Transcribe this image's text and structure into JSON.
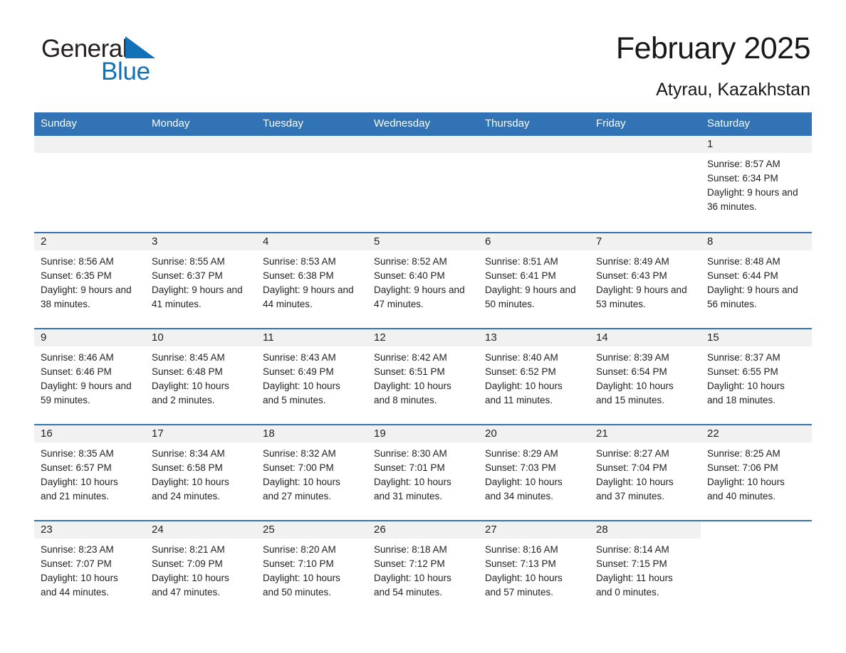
{
  "logo": {
    "word1": "General",
    "word2": "Blue",
    "triangle_color": "#1272b8"
  },
  "header": {
    "title": "February 2025",
    "subtitle": "Atyrau, Kazakhstan",
    "accent_color": "#3173b4"
  },
  "calendar": {
    "weekdays": [
      "Sunday",
      "Monday",
      "Tuesday",
      "Wednesday",
      "Thursday",
      "Friday",
      "Saturday"
    ],
    "labels": {
      "sunrise": "Sunrise:",
      "sunset": "Sunset:",
      "daylight": "Daylight:"
    },
    "weeks": [
      [
        {
          "day": "",
          "empty": true
        },
        {
          "day": "",
          "empty": true
        },
        {
          "day": "",
          "empty": true
        },
        {
          "day": "",
          "empty": true
        },
        {
          "day": "",
          "empty": true
        },
        {
          "day": "",
          "empty": true
        },
        {
          "day": "1",
          "sunrise": "Sunrise: 8:57 AM",
          "sunset": "Sunset: 6:34 PM",
          "daylight": "Daylight: 9 hours and 36 minutes."
        }
      ],
      [
        {
          "day": "2",
          "sunrise": "Sunrise: 8:56 AM",
          "sunset": "Sunset: 6:35 PM",
          "daylight": "Daylight: 9 hours and 38 minutes."
        },
        {
          "day": "3",
          "sunrise": "Sunrise: 8:55 AM",
          "sunset": "Sunset: 6:37 PM",
          "daylight": "Daylight: 9 hours and 41 minutes."
        },
        {
          "day": "4",
          "sunrise": "Sunrise: 8:53 AM",
          "sunset": "Sunset: 6:38 PM",
          "daylight": "Daylight: 9 hours and 44 minutes."
        },
        {
          "day": "5",
          "sunrise": "Sunrise: 8:52 AM",
          "sunset": "Sunset: 6:40 PM",
          "daylight": "Daylight: 9 hours and 47 minutes."
        },
        {
          "day": "6",
          "sunrise": "Sunrise: 8:51 AM",
          "sunset": "Sunset: 6:41 PM",
          "daylight": "Daylight: 9 hours and 50 minutes."
        },
        {
          "day": "7",
          "sunrise": "Sunrise: 8:49 AM",
          "sunset": "Sunset: 6:43 PM",
          "daylight": "Daylight: 9 hours and 53 minutes."
        },
        {
          "day": "8",
          "sunrise": "Sunrise: 8:48 AM",
          "sunset": "Sunset: 6:44 PM",
          "daylight": "Daylight: 9 hours and 56 minutes."
        }
      ],
      [
        {
          "day": "9",
          "sunrise": "Sunrise: 8:46 AM",
          "sunset": "Sunset: 6:46 PM",
          "daylight": "Daylight: 9 hours and 59 minutes."
        },
        {
          "day": "10",
          "sunrise": "Sunrise: 8:45 AM",
          "sunset": "Sunset: 6:48 PM",
          "daylight": "Daylight: 10 hours and 2 minutes."
        },
        {
          "day": "11",
          "sunrise": "Sunrise: 8:43 AM",
          "sunset": "Sunset: 6:49 PM",
          "daylight": "Daylight: 10 hours and 5 minutes."
        },
        {
          "day": "12",
          "sunrise": "Sunrise: 8:42 AM",
          "sunset": "Sunset: 6:51 PM",
          "daylight": "Daylight: 10 hours and 8 minutes."
        },
        {
          "day": "13",
          "sunrise": "Sunrise: 8:40 AM",
          "sunset": "Sunset: 6:52 PM",
          "daylight": "Daylight: 10 hours and 11 minutes."
        },
        {
          "day": "14",
          "sunrise": "Sunrise: 8:39 AM",
          "sunset": "Sunset: 6:54 PM",
          "daylight": "Daylight: 10 hours and 15 minutes."
        },
        {
          "day": "15",
          "sunrise": "Sunrise: 8:37 AM",
          "sunset": "Sunset: 6:55 PM",
          "daylight": "Daylight: 10 hours and 18 minutes."
        }
      ],
      [
        {
          "day": "16",
          "sunrise": "Sunrise: 8:35 AM",
          "sunset": "Sunset: 6:57 PM",
          "daylight": "Daylight: 10 hours and 21 minutes."
        },
        {
          "day": "17",
          "sunrise": "Sunrise: 8:34 AM",
          "sunset": "Sunset: 6:58 PM",
          "daylight": "Daylight: 10 hours and 24 minutes."
        },
        {
          "day": "18",
          "sunrise": "Sunrise: 8:32 AM",
          "sunset": "Sunset: 7:00 PM",
          "daylight": "Daylight: 10 hours and 27 minutes."
        },
        {
          "day": "19",
          "sunrise": "Sunrise: 8:30 AM",
          "sunset": "Sunset: 7:01 PM",
          "daylight": "Daylight: 10 hours and 31 minutes."
        },
        {
          "day": "20",
          "sunrise": "Sunrise: 8:29 AM",
          "sunset": "Sunset: 7:03 PM",
          "daylight": "Daylight: 10 hours and 34 minutes."
        },
        {
          "day": "21",
          "sunrise": "Sunrise: 8:27 AM",
          "sunset": "Sunset: 7:04 PM",
          "daylight": "Daylight: 10 hours and 37 minutes."
        },
        {
          "day": "22",
          "sunrise": "Sunrise: 8:25 AM",
          "sunset": "Sunset: 7:06 PM",
          "daylight": "Daylight: 10 hours and 40 minutes."
        }
      ],
      [
        {
          "day": "23",
          "sunrise": "Sunrise: 8:23 AM",
          "sunset": "Sunset: 7:07 PM",
          "daylight": "Daylight: 10 hours and 44 minutes."
        },
        {
          "day": "24",
          "sunrise": "Sunrise: 8:21 AM",
          "sunset": "Sunset: 7:09 PM",
          "daylight": "Daylight: 10 hours and 47 minutes."
        },
        {
          "day": "25",
          "sunrise": "Sunrise: 8:20 AM",
          "sunset": "Sunset: 7:10 PM",
          "daylight": "Daylight: 10 hours and 50 minutes."
        },
        {
          "day": "26",
          "sunrise": "Sunrise: 8:18 AM",
          "sunset": "Sunset: 7:12 PM",
          "daylight": "Daylight: 10 hours and 54 minutes."
        },
        {
          "day": "27",
          "sunrise": "Sunrise: 8:16 AM",
          "sunset": "Sunset: 7:13 PM",
          "daylight": "Daylight: 10 hours and 57 minutes."
        },
        {
          "day": "28",
          "sunrise": "Sunrise: 8:14 AM",
          "sunset": "Sunset: 7:15 PM",
          "daylight": "Daylight: 11 hours and 0 minutes."
        },
        {
          "day": "",
          "empty": true,
          "blank": true
        }
      ]
    ]
  }
}
